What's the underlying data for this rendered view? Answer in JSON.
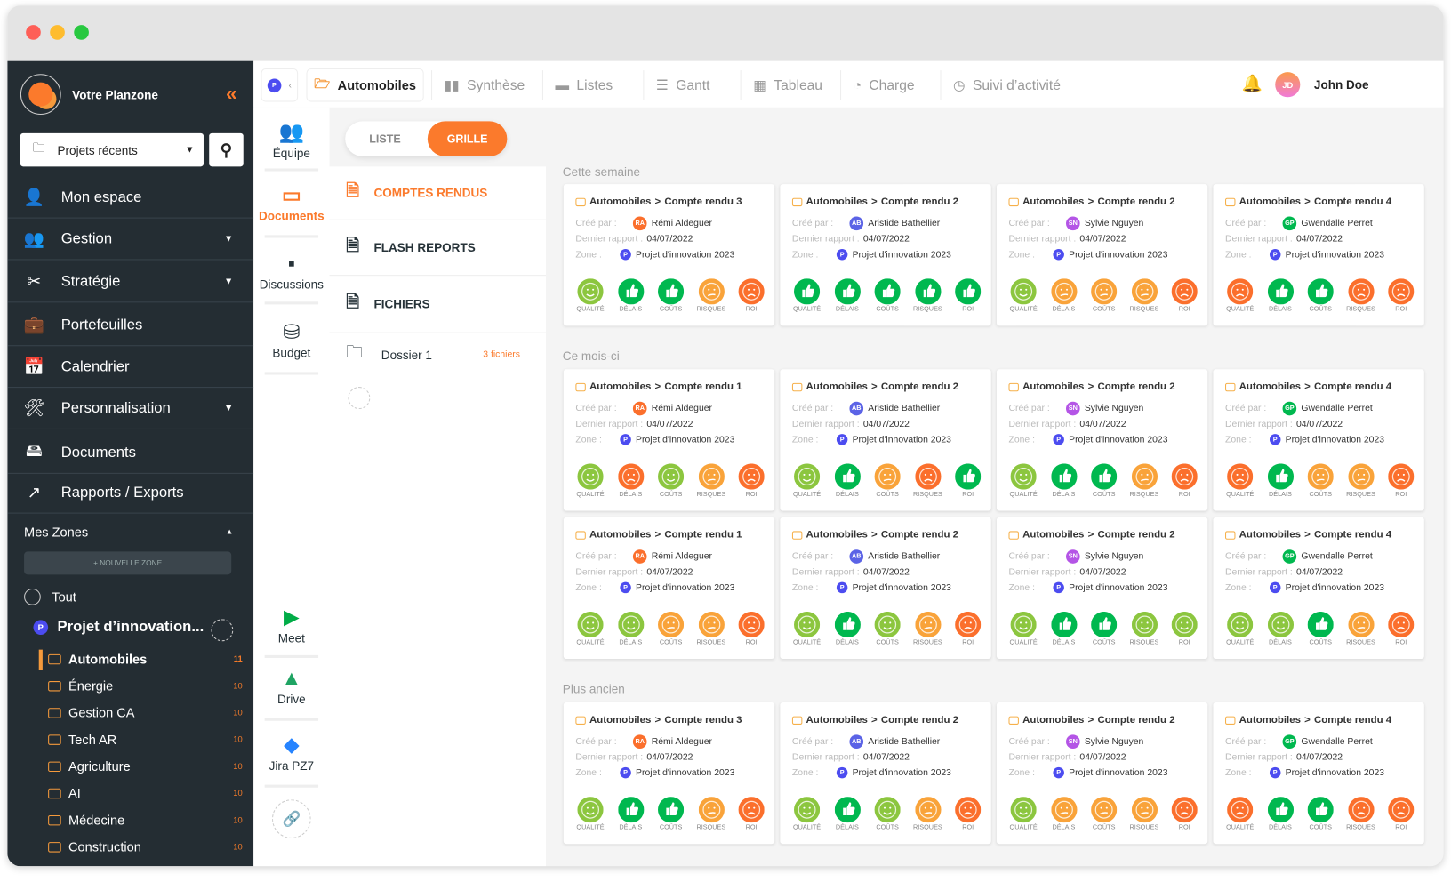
{
  "brand": {
    "name": "Votre Planzone"
  },
  "sidebar": {
    "recent": "Projets récents",
    "items": [
      {
        "label": "Mon espace",
        "icon": "👤"
      },
      {
        "label": "Gestion",
        "icon": "👥",
        "caret": true
      },
      {
        "label": "Stratégie",
        "icon": "✂",
        "caret": true
      },
      {
        "label": "Portefeuilles",
        "icon": "💼"
      },
      {
        "label": "Calendrier",
        "icon": "📅"
      },
      {
        "label": "Personnalisation",
        "icon": "🛠",
        "caret": true
      },
      {
        "label": "Documents",
        "icon": "🖴"
      },
      {
        "label": "Rapports / Exports",
        "icon": "↗"
      }
    ],
    "zones_title": "Mes Zones",
    "new_zone": "+ NOUVELLE ZONE",
    "all": "Tout",
    "project": "Projet d’innovation...",
    "project_badge": "P",
    "folders": [
      {
        "label": "Automobiles",
        "count": "11"
      },
      {
        "label": "Énergie",
        "count": "10"
      },
      {
        "label": "Gestion CA",
        "count": "10"
      },
      {
        "label": "Tech AR",
        "count": "10"
      },
      {
        "label": "Agriculture",
        "count": "10"
      },
      {
        "label": "AI",
        "count": "10"
      },
      {
        "label": "Médecine",
        "count": "10"
      },
      {
        "label": "Construction",
        "count": "10"
      }
    ]
  },
  "toolbar": {
    "badge": "P",
    "current": "Automobiles",
    "tabs": [
      "Synthèse",
      "Listes",
      "Gantt",
      "Tableau",
      "Charge",
      "Suivi d’activité"
    ],
    "user_initials": "JD",
    "user": "John Doe"
  },
  "iconcol": {
    "equipe": "Équipe",
    "documents": "Documents",
    "discussions": "Discussions",
    "budget": "Budget",
    "meet": "Meet",
    "drive": "Drive",
    "jira": "Jira PZ7"
  },
  "docmenu": {
    "comptes": "COMPTES RENDUS",
    "flash": "FLASH REPORTS",
    "fichiers": "FICHIERS",
    "dossier": "Dossier 1",
    "dossier_count": "3 fichiers"
  },
  "view": {
    "liste": "LISTE",
    "grille": "GRILLE"
  },
  "labels": {
    "cree": "Créé par :",
    "dernier": "Dernier rapport :",
    "zone": "Zone :",
    "indicators": [
      "QUALITÉ",
      "DÉLAIS",
      "COÛTS",
      "RISQUES",
      "ROI"
    ]
  },
  "colors": {
    "accent": "#fb7a2c",
    "smile": "#8cc63f",
    "thumb": "#00b84f",
    "neutral": "#f9a33a",
    "sad": "#fb6f2c"
  },
  "authors": [
    {
      "initials": "RA",
      "name": "Rémi Aldeguer",
      "color": "#fb6f2c"
    },
    {
      "initials": "AB",
      "name": "Aristide Bathellier",
      "color": "#5b63e6"
    },
    {
      "initials": "SN",
      "name": "Sylvie Nguyen",
      "color": "#b455e6"
    },
    {
      "initials": "GP",
      "name": "Gwendalle Perret",
      "color": "#00b84f"
    }
  ],
  "common": {
    "folder": "Automobiles",
    "date": "04/07/2022",
    "zone": "Projet d'innovation 2023",
    "zone_badge": "P"
  },
  "sections": [
    {
      "title": "Cette semaine",
      "cards": [
        {
          "title": "Compte rendu 3",
          "author": 0,
          "status": [
            "smile",
            "thumb",
            "thumb",
            "neutral",
            "sad"
          ]
        },
        {
          "title": "Compte rendu 2",
          "author": 1,
          "status": [
            "thumb",
            "thumb",
            "thumb",
            "thumb",
            "thumb"
          ]
        },
        {
          "title": "Compte rendu 2",
          "author": 2,
          "status": [
            "smile",
            "neutral",
            "neutral",
            "neutral",
            "sad"
          ]
        },
        {
          "title": "Compte rendu 4",
          "author": 3,
          "status": [
            "sad",
            "thumb",
            "thumb",
            "sad",
            "sad"
          ]
        }
      ]
    },
    {
      "title": "Ce mois-ci",
      "cards": [
        {
          "title": "Compte rendu 1",
          "author": 0,
          "status": [
            "smile",
            "sad",
            "smile",
            "neutral",
            "sad"
          ]
        },
        {
          "title": "Compte rendu 2",
          "author": 1,
          "status": [
            "smile",
            "thumb",
            "neutral",
            "sad",
            "thumb"
          ]
        },
        {
          "title": "Compte rendu 2",
          "author": 2,
          "status": [
            "smile",
            "thumb",
            "thumb",
            "neutral",
            "sad"
          ]
        },
        {
          "title": "Compte rendu 4",
          "author": 3,
          "status": [
            "sad",
            "thumb",
            "neutral",
            "neutral",
            "sad"
          ]
        },
        {
          "title": "Compte rendu 1",
          "author": 0,
          "status": [
            "smile",
            "smile",
            "neutral",
            "neutral",
            "sad"
          ]
        },
        {
          "title": "Compte rendu 2",
          "author": 1,
          "status": [
            "smile",
            "thumb",
            "smile",
            "neutral",
            "sad"
          ]
        },
        {
          "title": "Compte rendu 2",
          "author": 2,
          "status": [
            "smile",
            "thumb",
            "thumb",
            "smile",
            "smile"
          ]
        },
        {
          "title": "Compte rendu 4",
          "author": 3,
          "status": [
            "smile",
            "smile",
            "thumb",
            "neutral",
            "sad"
          ]
        }
      ]
    },
    {
      "title": "Plus ancien",
      "cards": [
        {
          "title": "Compte rendu 3",
          "author": 0,
          "status": [
            "smile",
            "thumb",
            "thumb",
            "neutral",
            "sad"
          ]
        },
        {
          "title": "Compte rendu 2",
          "author": 1,
          "status": [
            "smile",
            "thumb",
            "smile",
            "neutral",
            "sad"
          ]
        },
        {
          "title": "Compte rendu 2",
          "author": 2,
          "status": [
            "smile",
            "neutral",
            "neutral",
            "neutral",
            "sad"
          ]
        },
        {
          "title": "Compte rendu 4",
          "author": 3,
          "status": [
            "sad",
            "thumb",
            "thumb",
            "sad",
            "sad"
          ]
        }
      ]
    }
  ]
}
